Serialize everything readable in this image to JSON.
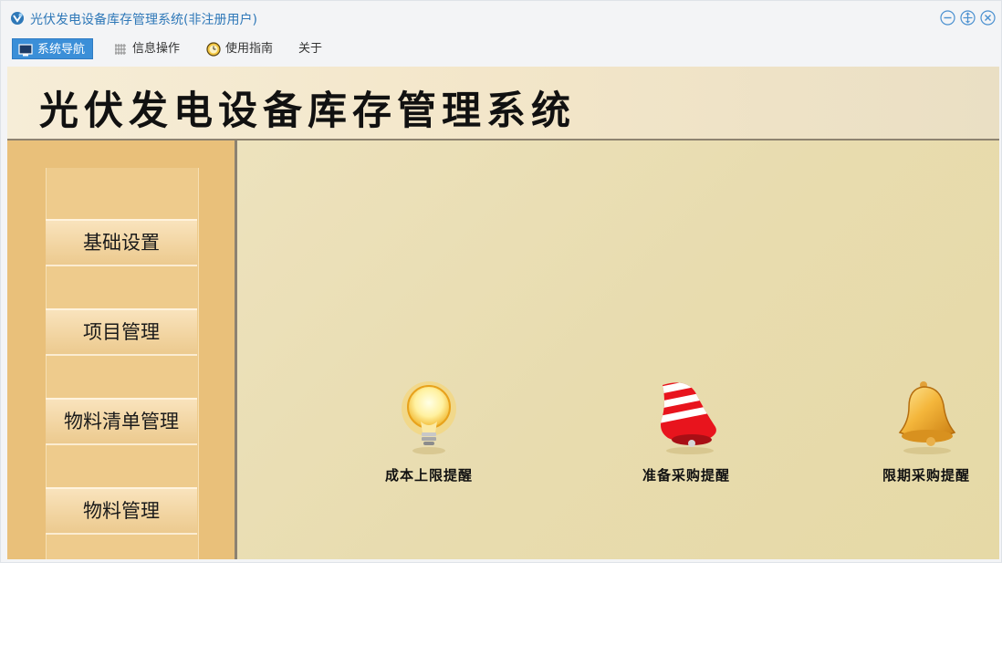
{
  "window": {
    "title": "光伏发电设备库存管理系统(非注册用户)",
    "accent": "#2f78b8"
  },
  "menu": [
    {
      "label": "系统导航",
      "icon": "monitor-icon",
      "active": true
    },
    {
      "label": "信息操作",
      "icon": "grid-icon",
      "active": false
    },
    {
      "label": "使用指南",
      "icon": "clock-icon",
      "active": false
    },
    {
      "label": "关于",
      "icon": "",
      "active": false
    }
  ],
  "banner": {
    "title": "光伏发电设备库存管理系统"
  },
  "sidebar": {
    "items": [
      {
        "label": "基础设置"
      },
      {
        "label": "项目管理"
      },
      {
        "label": "物料清单管理"
      },
      {
        "label": "物料管理"
      }
    ]
  },
  "alerts": [
    {
      "label": "成本上限提醒",
      "icon": "lightbulb-icon"
    },
    {
      "label": "准备采购提醒",
      "icon": "siren-bell-icon"
    },
    {
      "label": "限期采购提醒",
      "icon": "gold-bell-icon"
    }
  ]
}
